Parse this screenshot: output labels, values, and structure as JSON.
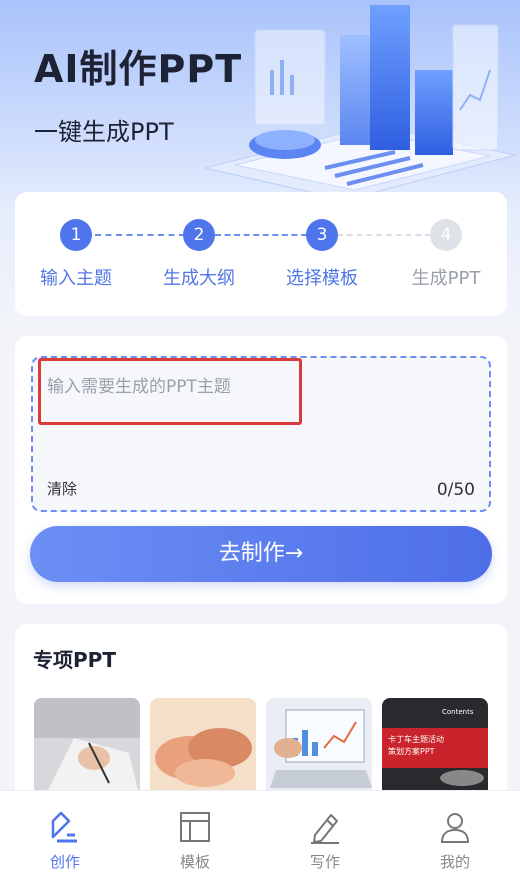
{
  "hero": {
    "title": "AI制作PPT",
    "subtitle": "一键生成PPT"
  },
  "steps": [
    {
      "number": "1",
      "label": "输入主题",
      "state": "active"
    },
    {
      "number": "2",
      "label": "生成大纲",
      "state": "active"
    },
    {
      "number": "3",
      "label": "选择模板",
      "state": "active"
    },
    {
      "number": "4",
      "label": "生成PPT",
      "state": "inactive"
    }
  ],
  "topic_input": {
    "placeholder": "输入需要生成的PPT主题",
    "value": "",
    "clear_label": "清除",
    "counter": "0/50"
  },
  "make_button": {
    "label": "去制作→"
  },
  "special": {
    "title": "专项PPT",
    "thumbnails": [
      {
        "icon": "writing-hand-photo"
      },
      {
        "icon": "holding-hands-photo"
      },
      {
        "icon": "laptop-dashboard-photo"
      },
      {
        "icon": "car-event-slide",
        "heading": "Contents",
        "text": "卡丁车主题活动\n策划方案PPT"
      }
    ]
  },
  "tabbar": {
    "items": [
      {
        "label": "创作",
        "icon": "create-icon",
        "active": true
      },
      {
        "label": "模板",
        "icon": "template-icon",
        "active": false
      },
      {
        "label": "写作",
        "icon": "pen-icon",
        "active": false
      },
      {
        "label": "我的",
        "icon": "user-icon",
        "active": false
      }
    ]
  },
  "colors": {
    "accent": "#4f75ec",
    "highlight_box": "#d93b3b",
    "background": "#f2f4f9"
  }
}
